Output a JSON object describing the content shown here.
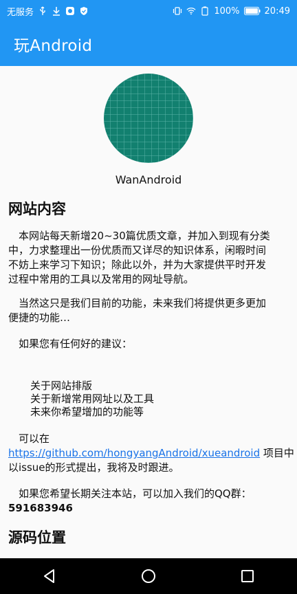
{
  "status_bar": {
    "carrier": "无服务",
    "battery": "100%",
    "time": "20:49"
  },
  "app_bar": {
    "title": "玩Android"
  },
  "header": {
    "site_name": "WanAndroid",
    "logo_icon": "grid-globe-logo"
  },
  "section1": {
    "title": "网站内容",
    "para1": [
      "　本网站每天新增20~30篇优质文章，并加入到现有分类",
      "中，力求整理出一份优质而又详尽的知识体系，闲暇时间",
      "不妨上来学习下知识；除此以外，并为大家提供平时开发",
      "过程中常用的工具以及常用的网址导航。"
    ],
    "para2": [
      "　当然这只是我们目前的功能，未来我们将提供更多更加",
      "便捷的功能…"
    ],
    "para3": "　如果您有任何好的建议：",
    "list": [
      "关于网站排版",
      "关于新增常用网址以及工具",
      "未来你希望增加的功能等"
    ],
    "para4_lead": "　可以在",
    "link": "https://github.com/hongyangAndroid/xueandroid",
    "para4_tail": " 项目中",
    "para4_line2": "以issue的形式提出，我将及时跟进。",
    "para5": "　如果您希望长期关注本站，可以加入我们的QQ群：",
    "qq_group": "591683946"
  },
  "section2": {
    "title": "源码位置"
  },
  "colors": {
    "primary": "#2196f3",
    "logo_teal": "#1a8a7a",
    "link": "#1a73e8"
  },
  "nav_bar": {
    "icons": [
      "back-icon",
      "home-icon",
      "recents-icon"
    ]
  }
}
